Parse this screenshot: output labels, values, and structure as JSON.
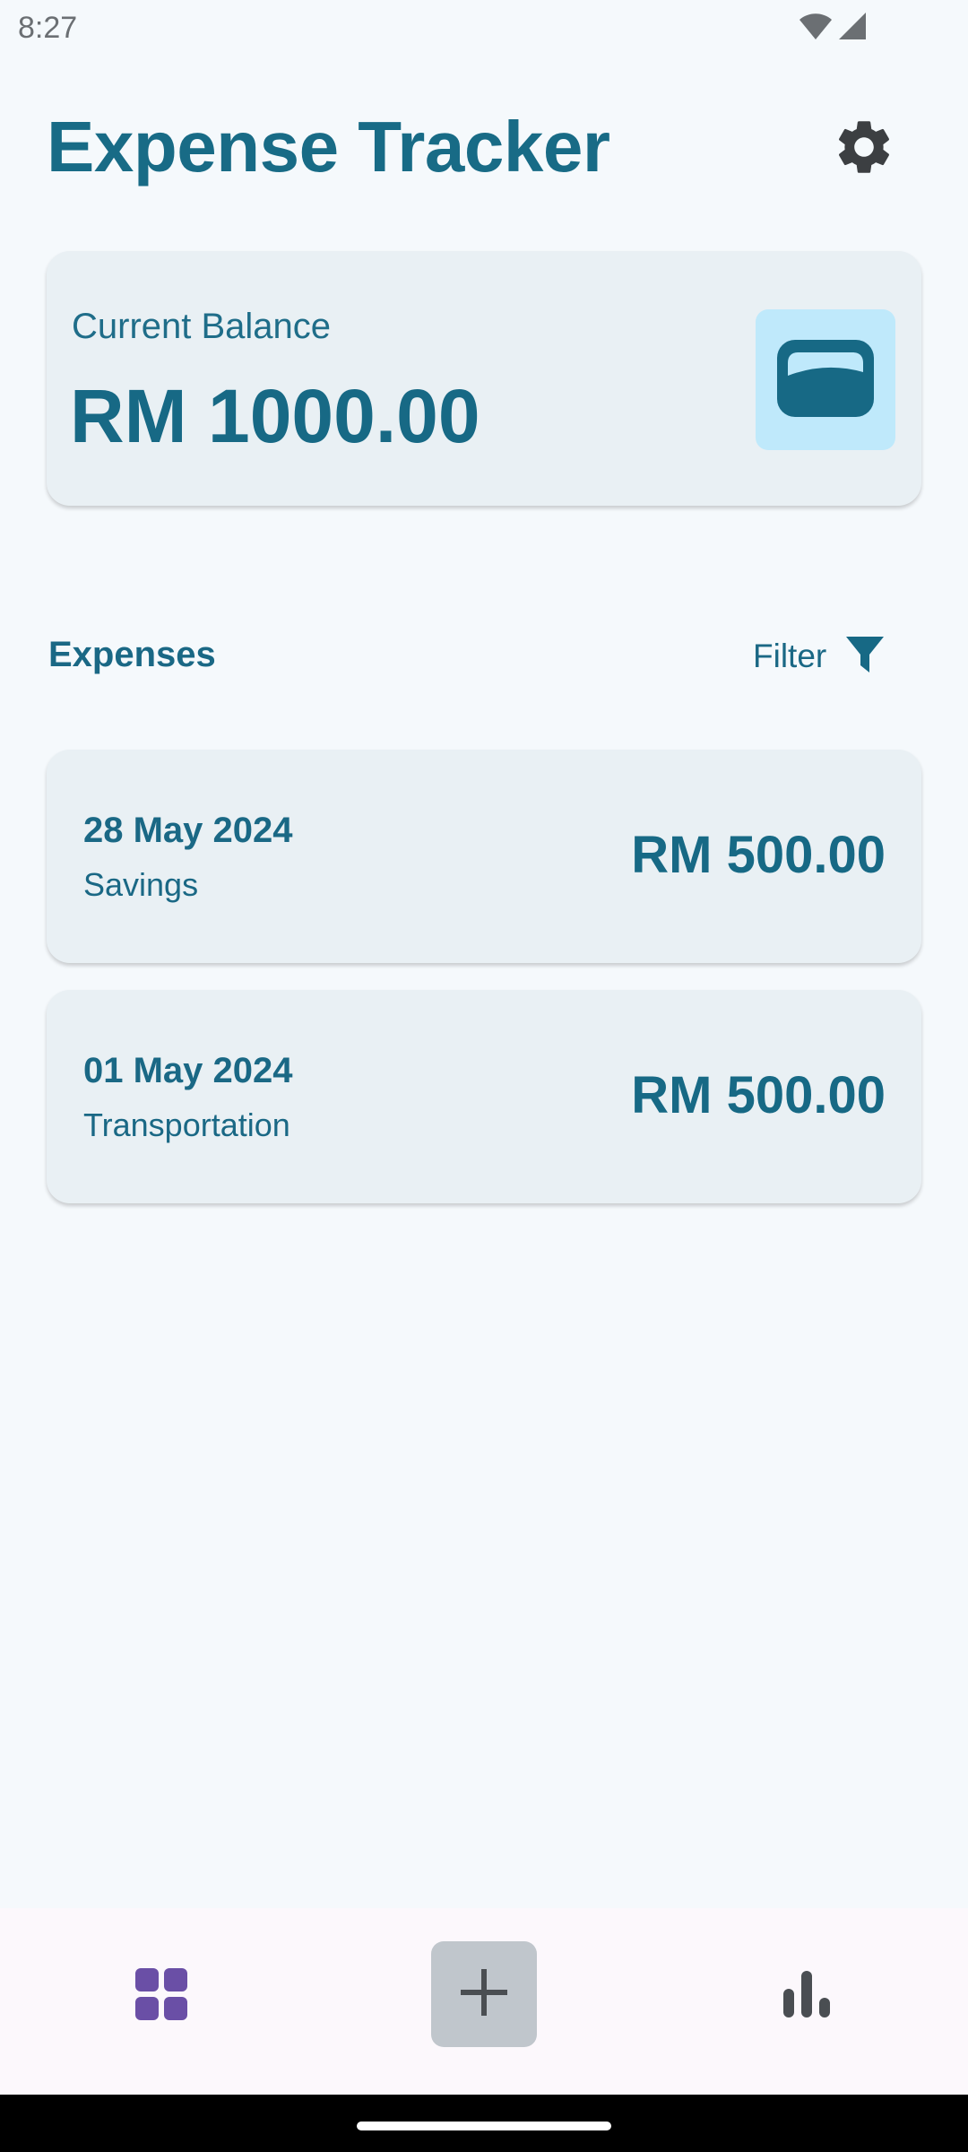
{
  "status_bar": {
    "time": "8:27",
    "icons": [
      "wifi-icon",
      "cell-signal-icon"
    ]
  },
  "header": {
    "title": "Expense Tracker",
    "settings_icon": "gear-icon"
  },
  "balance_card": {
    "label": "Current Balance",
    "amount": "RM 1000.00",
    "icon": "wallet-icon"
  },
  "expenses_section": {
    "title": "Expenses",
    "filter_label": "Filter",
    "filter_icon": "funnel-icon"
  },
  "expenses": [
    {
      "date": "28 May 2024",
      "category": "Savings",
      "amount": "RM 500.00"
    },
    {
      "date": "01 May 2024",
      "category": "Transportation",
      "amount": "RM 500.00"
    }
  ],
  "bottom_nav": {
    "items": [
      {
        "icon": "dashboard-grid-icon",
        "active": true
      },
      {
        "icon": "plus-icon",
        "active": false
      },
      {
        "icon": "bar-chart-icon",
        "active": false
      }
    ]
  },
  "colors": {
    "primary": "#186b86",
    "card_background": "#e9f0f4",
    "page_background": "#f5f9fc",
    "wallet_badge": "#bfe9fb",
    "nav_active": "#6a4fa6"
  }
}
